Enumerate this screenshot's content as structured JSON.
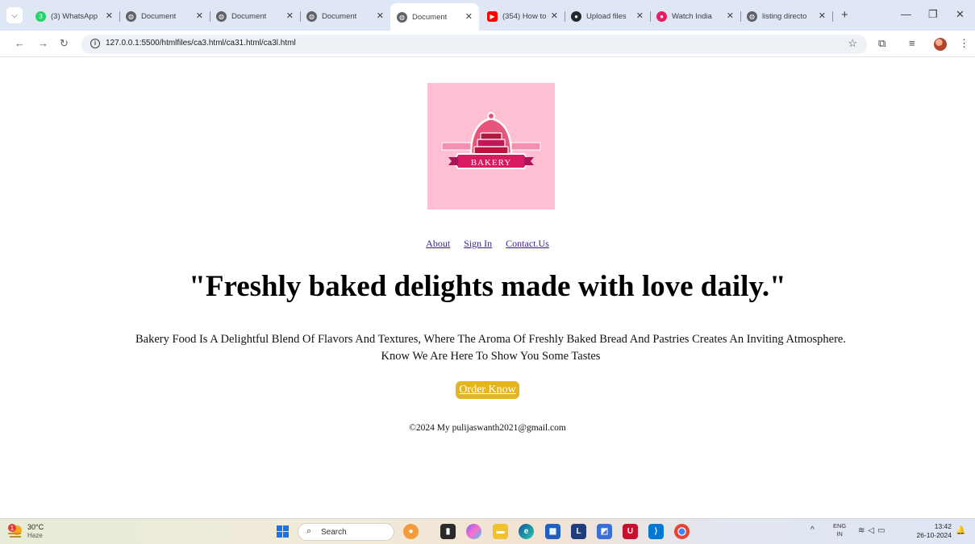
{
  "browser": {
    "tabs": [
      {
        "title": "(3) WhatsApp",
        "icon": "whatsapp-icon",
        "color": "#25d366"
      },
      {
        "title": "Document",
        "icon": "globe-icon",
        "color": "#5f6368"
      },
      {
        "title": "Document",
        "icon": "globe-icon",
        "color": "#5f6368"
      },
      {
        "title": "Document",
        "icon": "globe-icon",
        "color": "#5f6368"
      },
      {
        "title": "Document",
        "icon": "globe-icon",
        "color": "#5f6368",
        "active": true
      },
      {
        "title": "(354) How to",
        "icon": "youtube-icon",
        "color": "#ff0000"
      },
      {
        "title": "Upload files",
        "icon": "github-icon",
        "color": "#24292f"
      },
      {
        "title": "Watch India",
        "icon": "app-icon",
        "color": "#e91e63"
      },
      {
        "title": "listing directo",
        "icon": "globe-icon",
        "color": "#5f6368"
      }
    ],
    "url": "127.0.0.1:5500/htmlfiles/ca3.html/ca31.html/ca3l.html"
  },
  "page": {
    "logo": {
      "text": "BAKERY",
      "bg_color": "#fdbfd1",
      "accent_color": "#c2185b"
    },
    "nav": [
      "About",
      "Sign In",
      "Contact.Us"
    ],
    "headline": "\"Freshly baked delights made with love daily.\"",
    "description_line1": "Bakery Food Is A Delightful Blend Of Flavors And Textures, Where The Aroma Of Freshly Baked Bread And Pastries Creates An Inviting Atmosphere.",
    "description_line2": "Know We Are Here To Show You Some Tastes",
    "order_button": "Order Know",
    "order_button_color": "#e3b526",
    "footer": "©2024 My pulijaswanth2021@gmail.com"
  },
  "taskbar": {
    "weather_temp": "30°C",
    "weather_condition": "Haze",
    "weather_badge": "1",
    "search_label": "Search",
    "lang_top": "ENG",
    "lang_bottom": "IN",
    "time": "13:42",
    "date": "26-10-2024"
  }
}
